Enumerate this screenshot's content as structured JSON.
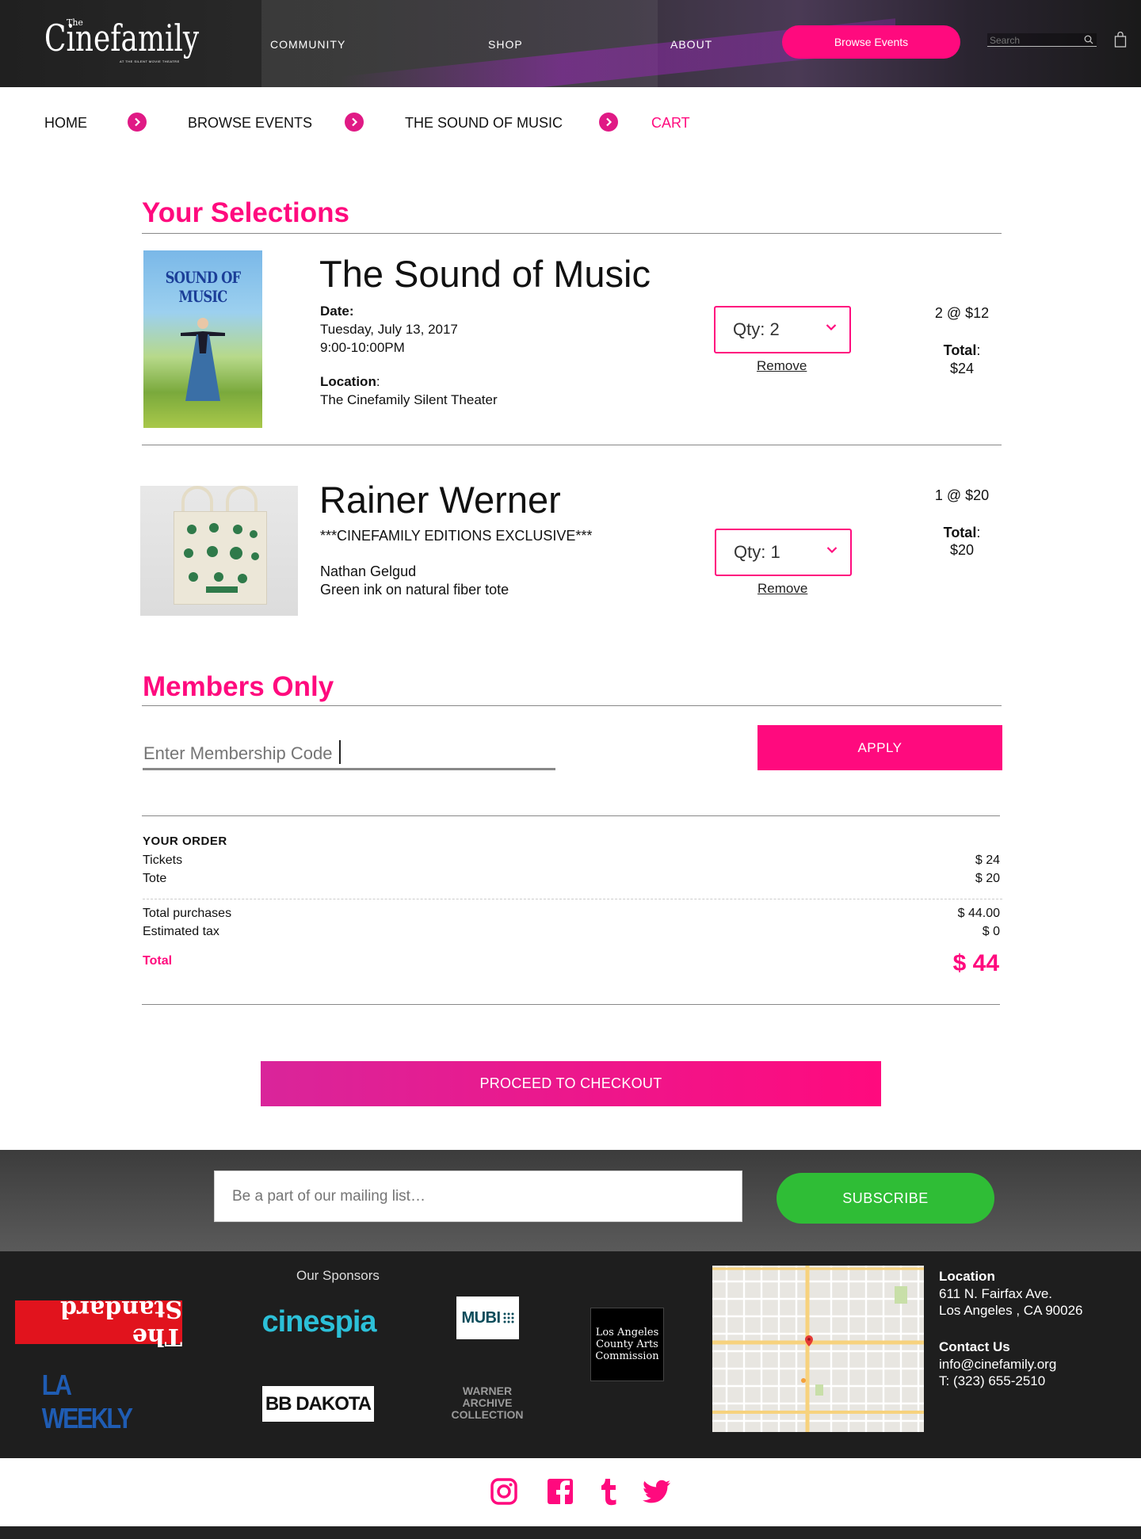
{
  "header": {
    "logo_the": "The",
    "logo_main": "Cinefamily",
    "logo_sub": "AT THE SILENT MOVIE THEATRE",
    "nav": [
      "COMMUNITY",
      "SHOP",
      "ABOUT"
    ],
    "browse_button": "Browse Events",
    "search_placeholder": "Search"
  },
  "breadcrumb": [
    "HOME",
    "BROWSE EVENTS",
    "THE SOUND OF MUSIC",
    "CART"
  ],
  "selections": {
    "title": "Your Selections",
    "items": [
      {
        "title": "The Sound of Music",
        "poster_title": "SOUND OF MUSIC",
        "date_label": "Date:",
        "date": "Tuesday, July 13, 2017",
        "time": "9:00-10:00PM",
        "location_label": "Location",
        "location": "The Cinefamily Silent Theater",
        "qty": "Qty: 2",
        "remove": "Remove",
        "unit_price": "2 @ $12",
        "total_label": "Total",
        "total": "$24"
      },
      {
        "title": "Rainer Werner",
        "subtitle": "***CINEFAMILY EDITIONS EXCLUSIVE***",
        "artist": "Nathan Gelgud",
        "description": "Green ink on natural fiber tote",
        "qty": "Qty: 1",
        "remove": "Remove",
        "unit_price": "1 @ $20",
        "total_label": "Total",
        "total": "$20"
      }
    ]
  },
  "members": {
    "title": "Members Only",
    "placeholder": "Enter Membership Code",
    "apply": "APPLY"
  },
  "order": {
    "heading": "YOUR ORDER",
    "rows": [
      {
        "label": "Tickets",
        "value": "$ 24"
      },
      {
        "label": "Tote",
        "value": "$ 20"
      }
    ],
    "subtotals": [
      {
        "label": "Total purchases",
        "value": "$ 44.00"
      },
      {
        "label": "Estimated tax",
        "value": "$ 0"
      }
    ],
    "total_label": "Total",
    "total_value": "$ 44"
  },
  "checkout_button": "PROCEED TO CHECKOUT",
  "mailing": {
    "placeholder": "Be a part of our mailing list…",
    "button": "SUBSCRIBE"
  },
  "footer": {
    "sponsors_title": "Our Sponsors",
    "sponsors": [
      "The Standard",
      "cinespia",
      "MUBI",
      "Los Angeles County Arts Commission",
      "LA WEEKLY",
      "BB DAKOTA",
      "WARNER ARCHIVE COLLECTION"
    ],
    "location_title": "Location",
    "address1": "611 N. Fairfax Ave.",
    "address2": "Los Angeles , CA 90026",
    "contact_title": "Contact Us",
    "email": "info@cinefamily.org",
    "phone": "T: (323) 655-2510"
  },
  "social": [
    "instagram-icon",
    "facebook-icon",
    "tumblr-icon",
    "twitter-icon"
  ],
  "colors": {
    "accent": "#ff0a7e",
    "subscribe": "#2fbd36"
  }
}
